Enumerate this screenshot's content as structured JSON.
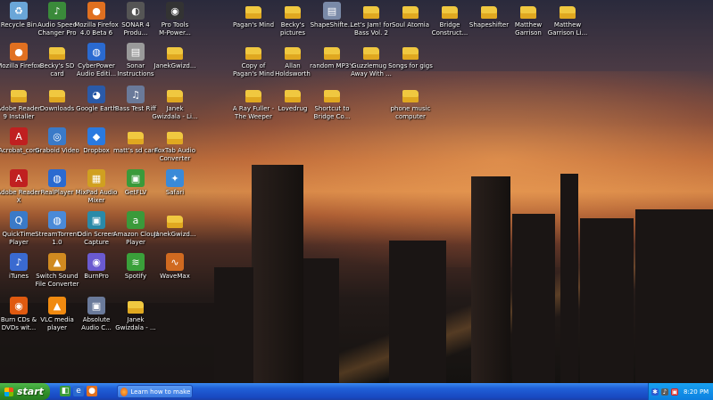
{
  "desktop": {
    "icons": [
      {
        "label": "Recycle Bin",
        "icon": "recycle-bin-icon",
        "kind": "app",
        "glyph": "♻",
        "color": "#6aa6d8"
      },
      {
        "label": "Audio Speed\nChanger Pro",
        "icon": "music-note-icon",
        "kind": "app",
        "glyph": "♪",
        "color": "#3a8a3a"
      },
      {
        "label": "Mozilla Firefox\n4.0 Beta 6",
        "icon": "firefox-icon",
        "kind": "app",
        "glyph": "●",
        "color": "#e07020"
      },
      {
        "label": "SONAR 4\nProdu...",
        "icon": "sonar-icon",
        "kind": "app",
        "glyph": "◐",
        "color": "#555555"
      },
      {
        "label": "Pro Tools\nM-Power...",
        "icon": "pro-tools-icon",
        "kind": "app",
        "glyph": "◉",
        "color": "#333333"
      },
      {
        "label": "Pagan's Mind",
        "icon": "folder-icon",
        "kind": "folder"
      },
      {
        "label": "Becky's\npictures",
        "icon": "folder-icon",
        "kind": "folder"
      },
      {
        "label": "ShapeShifte...",
        "icon": "document-icon",
        "kind": "app",
        "glyph": "▤",
        "color": "#7a8aa8"
      },
      {
        "label": "Let's Jam! for\nBass Vol. 2",
        "icon": "folder-icon",
        "kind": "folder"
      },
      {
        "label": "Soul Atomia",
        "icon": "folder-icon",
        "kind": "folder"
      },
      {
        "label": "Bridge\nConstruct...",
        "icon": "folder-icon",
        "kind": "folder"
      },
      {
        "label": "Shapeshifter",
        "icon": "folder-icon",
        "kind": "folder"
      },
      {
        "label": "Matthew\nGarrison",
        "icon": "folder-icon",
        "kind": "folder"
      },
      {
        "label": "Matthew\nGarrison Li...",
        "icon": "folder-icon",
        "kind": "folder"
      },
      {
        "label": "Mozilla Firefox",
        "icon": "firefox-icon",
        "kind": "app",
        "glyph": "●",
        "color": "#e07020"
      },
      {
        "label": "Becky's SD\ncard",
        "icon": "folder-icon",
        "kind": "folder"
      },
      {
        "label": "CyberPower\nAudio Editi...",
        "icon": "globe-icon",
        "kind": "app",
        "glyph": "◍",
        "color": "#2a6ad0"
      },
      {
        "label": "Sonar\nInstructions",
        "icon": "document-icon",
        "kind": "app",
        "glyph": "▤",
        "color": "#9a9a9a"
      },
      {
        "label": "JanekGwizd...",
        "icon": "folder-icon",
        "kind": "folder"
      },
      {
        "label": "Copy of\nPagan's Mind",
        "icon": "folder-icon",
        "kind": "folder"
      },
      {
        "label": "Allan\nHoldsworth",
        "icon": "folder-icon",
        "kind": "folder"
      },
      {
        "label": "random MP3's",
        "icon": "folder-icon",
        "kind": "folder"
      },
      {
        "label": "Guzzlemug -\nAway With ...",
        "icon": "folder-icon",
        "kind": "folder"
      },
      {
        "label": "Songs for gigs",
        "icon": "folder-icon",
        "kind": "folder"
      },
      {
        "label": "Adobe Reader\n9 Installer",
        "icon": "folder-icon",
        "kind": "folder"
      },
      {
        "label": "Downloads",
        "icon": "folder-icon",
        "kind": "folder"
      },
      {
        "label": "Google Earth",
        "icon": "google-earth-icon",
        "kind": "app",
        "glyph": "◕",
        "color": "#2a5aa8"
      },
      {
        "label": "Bass Test Riff",
        "icon": "audio-file-icon",
        "kind": "app",
        "glyph": "♫",
        "color": "#6a7a9a"
      },
      {
        "label": "Janek\nGwizdala - Li...",
        "icon": "folder-icon",
        "kind": "folder"
      },
      {
        "label": "A Ray Fuller -\nThe Weeper",
        "icon": "folder-icon",
        "kind": "folder"
      },
      {
        "label": "Lovedrug",
        "icon": "folder-icon",
        "kind": "folder"
      },
      {
        "label": "Shortcut to\nBridge Co...",
        "icon": "folder-shortcut-icon",
        "kind": "folder"
      },
      {
        "label": "phone music\ncomputer",
        "icon": "folder-icon",
        "kind": "folder"
      },
      {
        "label": "Acrobat_com",
        "icon": "acrobat-icon",
        "kind": "app",
        "glyph": "A",
        "color": "#c02020"
      },
      {
        "label": "Graboid Video",
        "icon": "graboid-icon",
        "kind": "app",
        "glyph": "◎",
        "color": "#3a7ac8"
      },
      {
        "label": "Dropbox",
        "icon": "dropbox-icon",
        "kind": "app",
        "glyph": "◆",
        "color": "#2a7ae0"
      },
      {
        "label": "matt's sd card",
        "icon": "folder-icon",
        "kind": "folder"
      },
      {
        "label": "FoxTab Audio\nConverter",
        "icon": "folder-icon",
        "kind": "folder"
      },
      {
        "label": "Adobe Reader\nX",
        "icon": "adobe-reader-icon",
        "kind": "app",
        "glyph": "A",
        "color": "#c02020"
      },
      {
        "label": "RealPlayer",
        "icon": "realplayer-icon",
        "kind": "app",
        "glyph": "◍",
        "color": "#2a6ad0"
      },
      {
        "label": "MixPad Audio\nMixer",
        "icon": "mixpad-icon",
        "kind": "app",
        "glyph": "▦",
        "color": "#d0a020"
      },
      {
        "label": "GetFLV",
        "icon": "getflv-icon",
        "kind": "app",
        "glyph": "▣",
        "color": "#3a9a3a"
      },
      {
        "label": "Safari",
        "icon": "safari-icon",
        "kind": "app",
        "glyph": "✦",
        "color": "#3a8ad8"
      },
      {
        "label": "QuickTime\nPlayer",
        "icon": "quicktime-icon",
        "kind": "app",
        "glyph": "Q",
        "color": "#3a7ac8"
      },
      {
        "label": "StreamTorrent\n1.0",
        "icon": "streamtorrent-icon",
        "kind": "app",
        "glyph": "◍",
        "color": "#4a8ad8"
      },
      {
        "label": "Odin Screen\nCapture",
        "icon": "odin-icon",
        "kind": "app",
        "glyph": "▣",
        "color": "#2a8aa8"
      },
      {
        "label": "Amazon Cloud\nPlayer",
        "icon": "amazon-icon",
        "kind": "app",
        "glyph": "a",
        "color": "#3a9a3a"
      },
      {
        "label": "JanekGwizd...",
        "icon": "folder-icon",
        "kind": "folder"
      },
      {
        "label": "iTunes",
        "icon": "itunes-icon",
        "kind": "app",
        "glyph": "♪",
        "color": "#3a6ad0"
      },
      {
        "label": "Switch Sound\nFile Converter",
        "icon": "switch-icon",
        "kind": "app",
        "glyph": "▲",
        "color": "#d08a20"
      },
      {
        "label": "BurnPro",
        "icon": "burnpro-icon",
        "kind": "app",
        "glyph": "◉",
        "color": "#6a5ad0"
      },
      {
        "label": "Spotify",
        "icon": "spotify-icon",
        "kind": "app",
        "glyph": "≋",
        "color": "#3aa03a"
      },
      {
        "label": "WaveMax",
        "icon": "wavemax-icon",
        "kind": "app",
        "glyph": "∿",
        "color": "#d06a20"
      },
      {
        "label": "Burn CDs &\nDVDs wit...",
        "icon": "burn-disc-icon",
        "kind": "app",
        "glyph": "◉",
        "color": "#e05a10"
      },
      {
        "label": "VLC media\nplayer",
        "icon": "vlc-icon",
        "kind": "app",
        "glyph": "▲",
        "color": "#f08a10"
      },
      {
        "label": "Absolute\nAudio C...",
        "icon": "absolute-audio-icon",
        "kind": "app",
        "glyph": "▣",
        "color": "#6a7a9a"
      },
      {
        "label": "Janek\nGwizdala - ...",
        "icon": "folder-icon",
        "kind": "folder"
      }
    ]
  },
  "taskbar": {
    "start_label": "start",
    "quick_launch": [
      {
        "icon": "show-desktop-icon",
        "glyph": "◧",
        "color": "#3a9a3a"
      },
      {
        "icon": "internet-explorer-icon",
        "glyph": "e",
        "color": "#2a6ad0"
      },
      {
        "icon": "firefox-icon",
        "glyph": "●",
        "color": "#e07020"
      }
    ],
    "active_task": "Learn how to make a ...",
    "tray": {
      "icons": [
        {
          "icon": "bluetooth-icon",
          "glyph": "✱",
          "color": "#2a5ad0"
        },
        {
          "icon": "volume-icon",
          "glyph": "♪",
          "color": "#5a5a5a"
        },
        {
          "icon": "network-icon",
          "glyph": "▣",
          "color": "#d02020"
        }
      ],
      "clock": "8:20 PM"
    }
  }
}
